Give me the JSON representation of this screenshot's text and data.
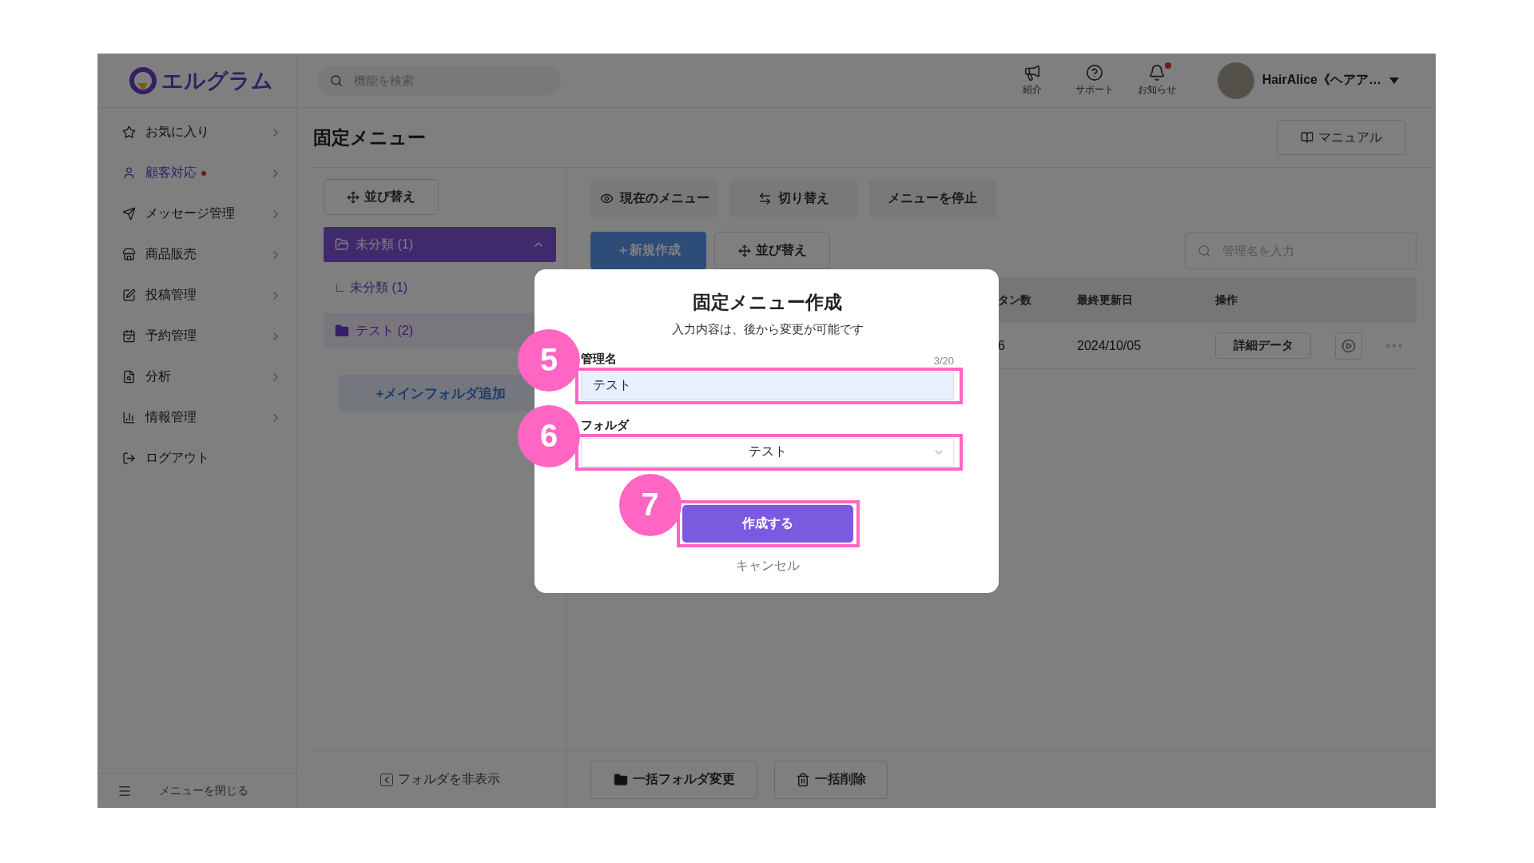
{
  "header": {
    "logo": "エルグラム",
    "search": {
      "placeholder": "機能を検索"
    },
    "actions": [
      {
        "kind": "speaker",
        "label": "紹介",
        "unread": false
      },
      {
        "kind": "help",
        "label": "サポート",
        "unread": false
      },
      {
        "kind": "bell",
        "label": "お知らせ",
        "unread": true
      }
    ],
    "user": {
      "name": "HairAlice《ヘアア…"
    }
  },
  "sidebar": {
    "items": [
      {
        "kind": "star",
        "label": "お気に入り",
        "selected": false,
        "has_dot": false
      },
      {
        "kind": "user",
        "label": "顧客対応",
        "selected": true,
        "has_dot": true
      },
      {
        "kind": "send",
        "label": "メッセージ管理",
        "selected": false,
        "has_dot": false
      },
      {
        "kind": "store",
        "label": "商品販売",
        "selected": false,
        "has_dot": false
      },
      {
        "kind": "edit",
        "label": "投稿管理",
        "selected": false,
        "has_dot": false
      },
      {
        "kind": "calendar",
        "label": "予約管理",
        "selected": false,
        "has_dot": false
      },
      {
        "kind": "analysis",
        "label": "分析",
        "selected": false,
        "has_dot": false
      },
      {
        "kind": "chart",
        "label": "情報管理",
        "selected": false,
        "has_dot": false
      },
      {
        "kind": "logout",
        "label": "ログアウト",
        "selected": false,
        "has_dot": false
      }
    ],
    "close_label": "メニューを閉じる"
  },
  "page": {
    "title": "固定メニュー",
    "manual_button": "マニュアル"
  },
  "folders": {
    "sort_button": "並び替え",
    "items": [
      {
        "label": "未分類 (1)",
        "selected": true,
        "expanded": true,
        "children": [
          {
            "label": "∟ 未分類 (1)"
          }
        ]
      },
      {
        "label": "テスト (2)",
        "selected": false,
        "expanded": false
      }
    ],
    "add_button": "+メインフォルダ追加",
    "hide_button": "フォルダを非表示"
  },
  "main": {
    "tabs": [
      {
        "kind": "eye",
        "label": "現在のメニュー"
      },
      {
        "kind": "switch",
        "label": "切り替え"
      },
      {
        "kind": "plain",
        "label": "メニューを停止"
      }
    ],
    "new_button": "＋新規作成",
    "sort_button": "並び替え",
    "search": {
      "placeholder": "管理名を入力"
    },
    "table": {
      "columns": [
        "タン数",
        "最終更新日",
        "操作"
      ],
      "rows": [
        {
          "column_1": "6",
          "updated": "2024/10/05",
          "action": "詳細データ"
        }
      ]
    },
    "bulk_buttons": [
      {
        "kind": "folder",
        "label": "一括フォルダ変更"
      },
      {
        "kind": "trash",
        "label": "一括削除"
      }
    ]
  },
  "modal": {
    "title": "固定メニュー作成",
    "subtitle": "入力内容は、後から変更が可能です",
    "fields": [
      {
        "kind": "text",
        "label": "管理名",
        "counter": "3/20",
        "value": "テスト",
        "step": "5"
      },
      {
        "kind": "select",
        "label": "フォルダ",
        "value": "テスト",
        "step": "6"
      }
    ],
    "submit": {
      "label": "作成する",
      "step": "7"
    },
    "cancel": "キャンセル"
  }
}
